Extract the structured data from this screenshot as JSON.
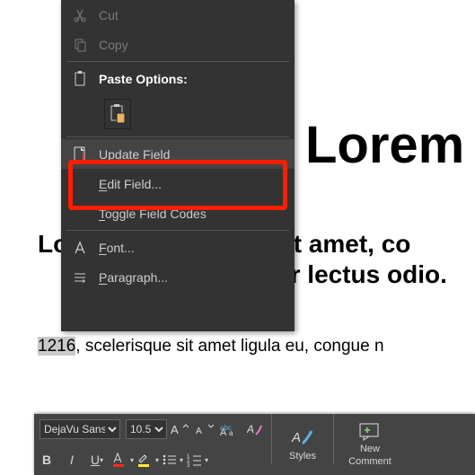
{
  "document": {
    "title": "Lorem",
    "paragraph1": "Lorem ipsum dolor sit amet, co",
    "paragraph2": "Nulla ullamcorper lectus odio.",
    "body1_prefix_highlighted": "1216",
    "body1_rest": ", scelerisque sit amet ligula eu, congue n"
  },
  "context_menu": {
    "cut": "Cut",
    "copy": "Copy",
    "paste_heading": "Paste Options:",
    "update_field": "Update Field",
    "edit_field": "Edit Field...",
    "toggle_field_codes": "Toggle Field Codes",
    "font": "Font...",
    "paragraph": "Paragraph..."
  },
  "toolbar": {
    "font_name": "DejaVu Sans",
    "font_size": "10.5",
    "styles_label": "Styles",
    "new_comment_label_l1": "New",
    "new_comment_label_l2": "Comment"
  }
}
